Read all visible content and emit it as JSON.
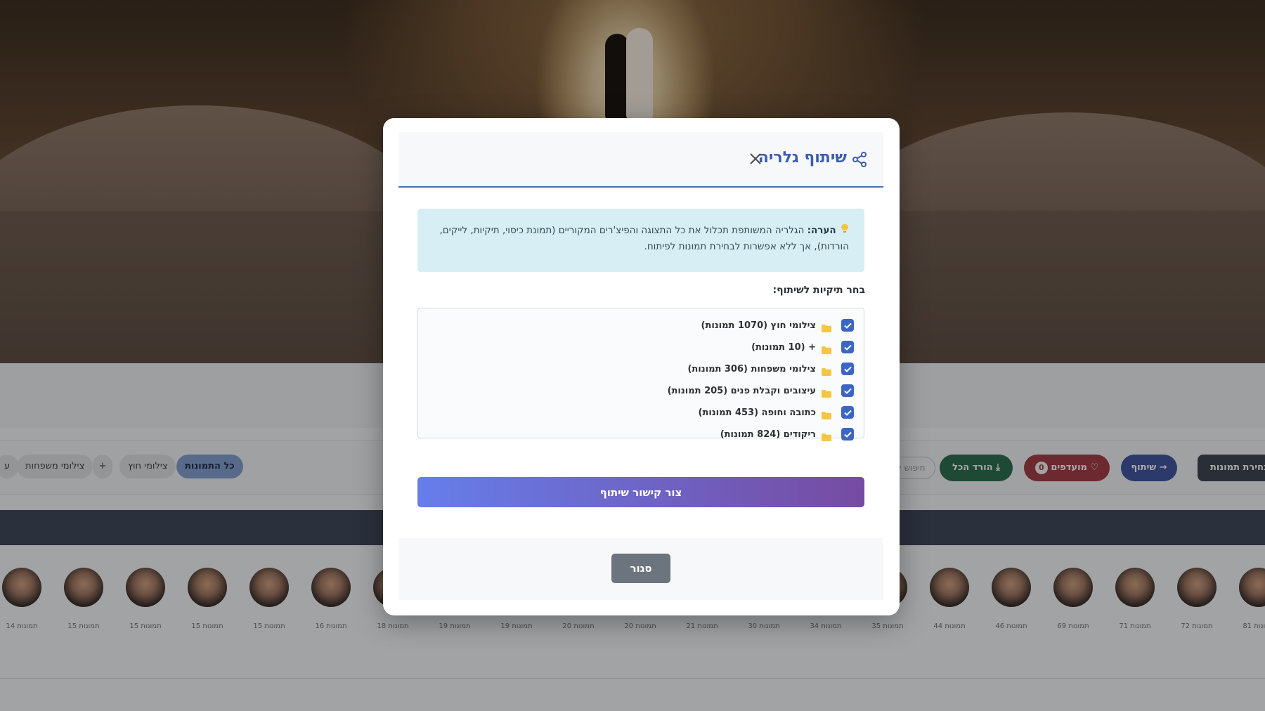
{
  "background": {
    "category_chips": [
      {
        "label": "כל התמונות",
        "active": true
      },
      {
        "label": "צילומי חוץ",
        "active": false
      },
      {
        "label": "+",
        "active": false
      },
      {
        "label": "צילומי משפחות",
        "active": false
      },
      {
        "label": "ע",
        "active": false
      }
    ],
    "actions": {
      "search_placeholder": "חיפוש ל",
      "download_all": "הורד הכל",
      "favorites": "מועדפים",
      "favorites_count": "0",
      "share": "שיתוף",
      "select_photos": "בחירת תמונות"
    },
    "people_counts": [
      "14 תמונות",
      "15 תמונות",
      "15 תמונות",
      "15 תמונות",
      "15 תמונות",
      "16 תמונות",
      "18 תמונות",
      "19 תמונות",
      "19 תמונות",
      "20 תמונות",
      "20 תמונות",
      "21 תמונות",
      "30 תמונות",
      "34 תמונות",
      "35 תמונות",
      "44 תמונות",
      "46 תמונות",
      "69 תמונות",
      "71 תמונות",
      "72 תמונות",
      "81 תמונות"
    ]
  },
  "modal": {
    "title": "שיתוף גלריה",
    "note_label": "הערה:",
    "note_text": "הגלריה המשותפת תכלול את כל התצוגה והפיצ'רים המקוריים (תמונת כיסוי, תיקיות, לייקים, הורדות), אך ללא אפשרות לבחירת תמונות לפיתוח.",
    "folders_label": "בחר תיקיות לשיתוף:",
    "folders": [
      {
        "label": "צילומי חוץ (1070 תמונות)",
        "checked": true
      },
      {
        "label": "+ (10 תמונות)",
        "checked": true
      },
      {
        "label": "צילומי משפחות (306 תמונות)",
        "checked": true
      },
      {
        "label": "עיצובים וקבלת פנים (205 תמונות)",
        "checked": true
      },
      {
        "label": "כתובה וחופה (453 תמונות)",
        "checked": true
      },
      {
        "label": "ריקודים (824 תמונות)",
        "checked": true
      }
    ],
    "create_link_label": "צור קישור שיתוף",
    "close_label": "סגור"
  },
  "colors": {
    "accent_blue": "#3d66c4",
    "title_blue": "#3b5cb0",
    "gradient_start": "#667eea",
    "gradient_end": "#764ba2",
    "note_bg": "#d8eef5",
    "close_button": "#6c757d",
    "folder_yellow": "#f6c544"
  }
}
